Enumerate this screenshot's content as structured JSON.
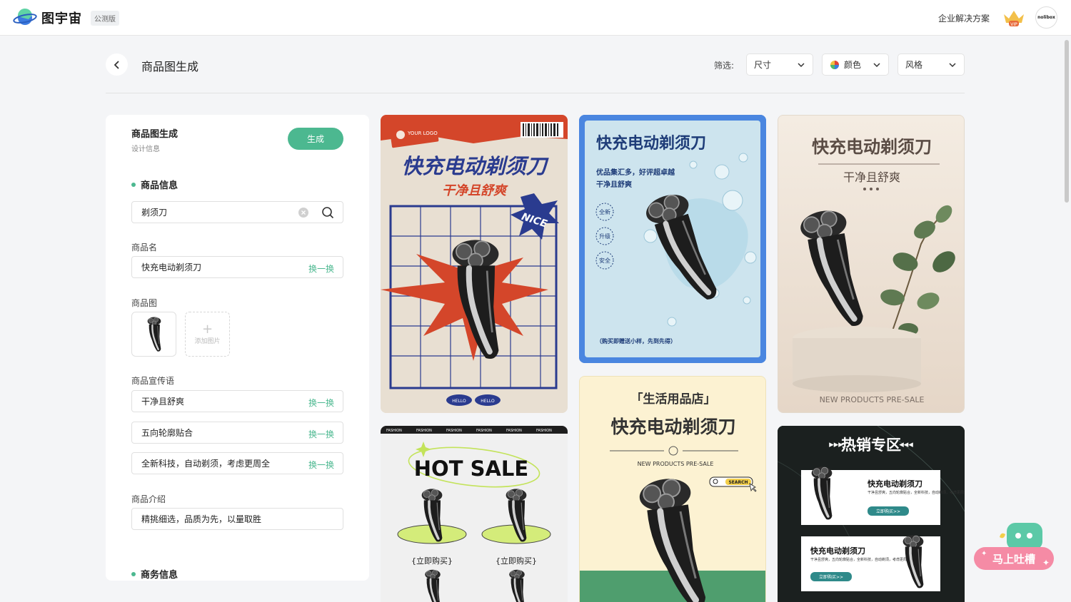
{
  "app": {
    "name": "图宇宙",
    "badge": "公测版",
    "enterprise": "企业解决方案",
    "avatar_text": "nolibox",
    "vip_text": "VIP"
  },
  "header": {
    "title": "商品图生成",
    "filter_label": "筛选:",
    "filters": [
      "尺寸",
      "颜色",
      "风格"
    ]
  },
  "panel": {
    "title": "商品图生成",
    "subtitle": "设计信息",
    "generate": "生成",
    "product_info": "商品信息",
    "search_value": "剃须刀",
    "name_label": "商品名",
    "name_value": "快充电动剃须刀",
    "image_label": "商品图",
    "add_image": "添加图片",
    "slogan_label": "商品宣传语",
    "slogans": [
      "干净且舒爽",
      "五向轮廓贴合",
      "全新科技，自动剃须，考虑更周全"
    ],
    "swap": "换一换",
    "intro_label": "商品介绍",
    "intro_value": "精挑细选，品质为先，以量取胜",
    "business_info": "商务信息"
  },
  "cards": {
    "c1": {
      "logo": "YOUR LOGO",
      "title": "快充电动剃须刀",
      "sub": "干净且舒爽",
      "nice": "NICE",
      "hello": "HELLO"
    },
    "c2": {
      "title": "快充电动剃须刀",
      "line1": "优品集汇多，好评超卓越",
      "line2": "干净且舒爽",
      "tags": [
        "全新",
        "升级",
        "安全"
      ],
      "foot": "（购买即赠送小样，先到先得）"
    },
    "c3": {
      "title": "快充电动剃须刀",
      "sub": "干净且舒爽",
      "foot": "NEW PRODUCTS PRE-SALE"
    },
    "c4": {
      "ribbon": "FASHION",
      "title": "HOT SALE",
      "buy": "{立即购买}"
    },
    "c5": {
      "tag": "「生活用品店」",
      "title": "快充电动剃须刀",
      "sub": "NEW PRODUCTS PRE-SALE",
      "search": "SEARCH"
    },
    "c6": {
      "title": "热销专区",
      "item_title": "快充电动剃须刀",
      "item_desc": "干净且舒爽，五向轮廓贴合，全新科技，自动剃须，考虑更周全",
      "buy": "立即购买>>"
    }
  },
  "feedback": {
    "label": "马上吐槽"
  },
  "colors": {
    "accent": "#4cb890",
    "blue_frame": "#4a86e0",
    "retro_red": "#d4462a",
    "retro_blue": "#2a3b8f"
  }
}
